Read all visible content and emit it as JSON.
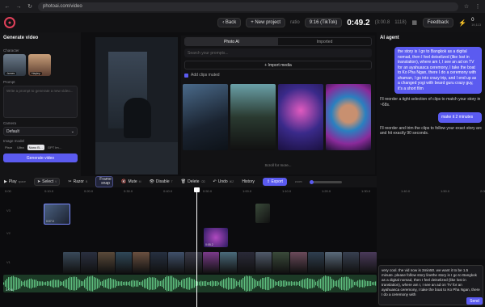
{
  "browser": {
    "url": "photoai.com/video"
  },
  "header": {
    "back": "Back",
    "new_project": "New project",
    "ratio_label": "ratio",
    "ratio_value": "9:16 (TikTok)",
    "time": "0:49.2",
    "time_total": "(3:00.8",
    "time_extra": "1118)",
    "feedback": "Feedback",
    "credits": "0",
    "credits_sub": "19,113"
  },
  "left": {
    "title": "Generate video",
    "character_label": "Character",
    "characters": [
      "James",
      "Hayley"
    ],
    "prompt_label": "Prompt",
    "prompt_placeholder": "Write a prompt to generate a new video...",
    "camera_label": "Camera",
    "camera_value": "Default",
    "model_label": "Image model",
    "models": [
      "Pixar",
      "Ultra",
      "Nano B…",
      "GPT Im…"
    ],
    "generate_btn": "Generate video"
  },
  "media": {
    "tabs": [
      "Photo AI",
      "Imported"
    ],
    "search_placeholder": "Search your prompts...",
    "import": "+ Import media",
    "checkbox": "Add clips muted",
    "scroll_hint": "Scroll for more..."
  },
  "agent": {
    "title": "AI agent",
    "messages": [
      {
        "role": "user",
        "text": "the story is I go to Bangkok as a digital nomad, then I feel deiselized (like lost in translation), where am I, I see an ad on TV for an ayahuasca ceremony, I take the boat to Ko Pha Ngan, there I do a ceremony with shaman, I go into crazy trip, and I end up as a changed yogi with beard guru crazy guy, it's a short film"
      },
      {
        "role": "bot",
        "text": "I'll reorder a tight selection of clips to match your story in ~68s."
      },
      {
        "role": "user",
        "text": "make it 2 minutes"
      },
      {
        "role": "bot",
        "text": "I'll reorder and trim the clips to follow your exact story arc and hit exactly 90 seconds."
      }
    ],
    "input_text": "very cool. the vid now is 3min50. we want it to be 1.5 minute. please follow story linethe story is I go to Bangkok as a digital nomad, then I feel deiselized (like lost in translation), where am I, I see an ad on TV for an ayahuasca ceremony, I take the boat to Ko Pha Ngan, there I do a ceremony with",
    "send": "Send"
  },
  "toolbar": {
    "play": "Play",
    "play_key": "space",
    "select": "Select",
    "select_key": "V",
    "razor": "Razor",
    "razor_key": "B",
    "frame_snap": "Frame snap",
    "mute": "Mute",
    "mute_key": "M",
    "disable": "Disable",
    "disable_key": "T",
    "delete": "Delete",
    "delete_key": "⌫",
    "undo": "Undo",
    "undo_key": "⌘Z",
    "history": "History",
    "export": "Export",
    "zoom_label": "zoom",
    "zoom_level": 0.05
  },
  "timeline": {
    "ruler": [
      "0:00",
      "0:10.0",
      "0:20.0",
      "0:30.0",
      "0:40.0",
      "0:50.0",
      "1:00.0",
      "1:10.0",
      "1:20.0",
      "1:30.0",
      "1:40.0",
      "1:50.0",
      "2:00.0"
    ],
    "track_labels": [
      "V3",
      "V2",
      "V1",
      "A1"
    ],
    "clips": {
      "c1": "0:07.0",
      "c2": "0:05.2",
      "audio": "3:0.8"
    }
  }
}
